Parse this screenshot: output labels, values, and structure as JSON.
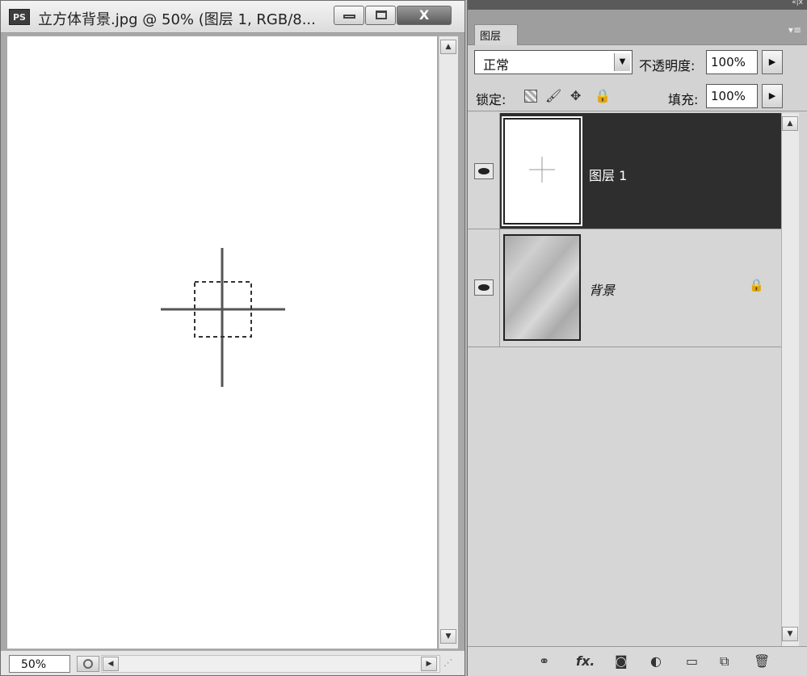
{
  "document": {
    "app_icon": "PS",
    "title": "立方体背景.jpg @ 50% (图层 1, RGB/8...",
    "zoom": "50%",
    "close_glyph": "X"
  },
  "panel": {
    "top_glyph": "«|x",
    "tab_label": "图层",
    "menu_glyph": "▾≡",
    "blend_mode": "正常",
    "opacity_label": "不透明度:",
    "opacity_value": "100%",
    "lock_label": "锁定:",
    "fill_label": "填充:",
    "fill_value": "100%",
    "layers": [
      {
        "name": "图层 1",
        "selected": true,
        "visible": true
      },
      {
        "name": "背景",
        "selected": false,
        "visible": true,
        "locked": true
      }
    ],
    "footer_icons": [
      "link-icon",
      "fx-icon",
      "mask-icon",
      "adjustment-icon",
      "group-icon",
      "new-layer-icon",
      "trash-icon"
    ],
    "footer_glyphs": {
      "fx": "fx."
    }
  },
  "colors": {
    "selected_layer": "#2e2e2e",
    "panel_bg": "#d3d3d3",
    "canvas": "#ffffff"
  }
}
